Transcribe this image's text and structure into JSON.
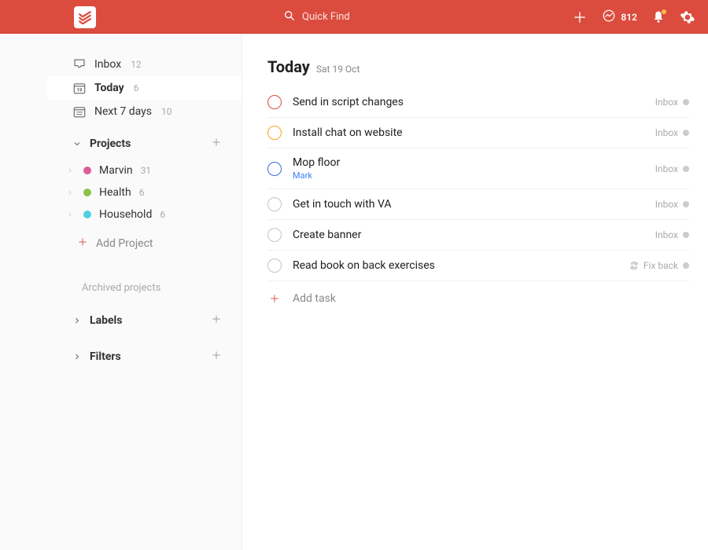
{
  "colors": {
    "brand": "#db4c3f"
  },
  "topbar": {
    "search_placeholder": "Quick Find",
    "karma_count": "812"
  },
  "sidebar": {
    "views": [
      {
        "icon": "inbox",
        "label": "Inbox",
        "count": "12",
        "active": false
      },
      {
        "icon": "calendar-day",
        "label": "Today",
        "count": "6",
        "active": true
      },
      {
        "icon": "calendar-week",
        "label": "Next 7 days",
        "count": "10",
        "active": false
      }
    ],
    "projects_label": "Projects",
    "projects": [
      {
        "name": "Marvin",
        "count": "31",
        "color": "#e05b9a"
      },
      {
        "name": "Health",
        "count": "6",
        "color": "#8bc34a"
      },
      {
        "name": "Household",
        "count": "6",
        "color": "#4dd0e1"
      }
    ],
    "add_project_label": "Add Project",
    "archived_label": "Archived projects",
    "labels_label": "Labels",
    "filters_label": "Filters"
  },
  "main": {
    "title": "Today",
    "date": "Sat 19 Oct",
    "add_task_label": "Add task",
    "tasks": [
      {
        "title": "Send in script changes",
        "priority_color": "#db4c3f",
        "project": "Inbox",
        "assignee": "",
        "recurring": false
      },
      {
        "title": "Install chat on website",
        "priority_color": "#f5a623",
        "project": "Inbox",
        "assignee": "",
        "recurring": false
      },
      {
        "title": "Mop floor",
        "priority_color": "#3b6cdb",
        "project": "Inbox",
        "assignee": "Mark",
        "recurring": false
      },
      {
        "title": "Get in touch with VA",
        "priority_color": "#c4c4c4",
        "project": "Inbox",
        "assignee": "",
        "recurring": false
      },
      {
        "title": "Create banner",
        "priority_color": "#c4c4c4",
        "project": "Inbox",
        "assignee": "",
        "recurring": false
      },
      {
        "title": "Read book on back exercises",
        "priority_color": "#c4c4c4",
        "project": "Fix back",
        "assignee": "",
        "recurring": true
      }
    ]
  }
}
